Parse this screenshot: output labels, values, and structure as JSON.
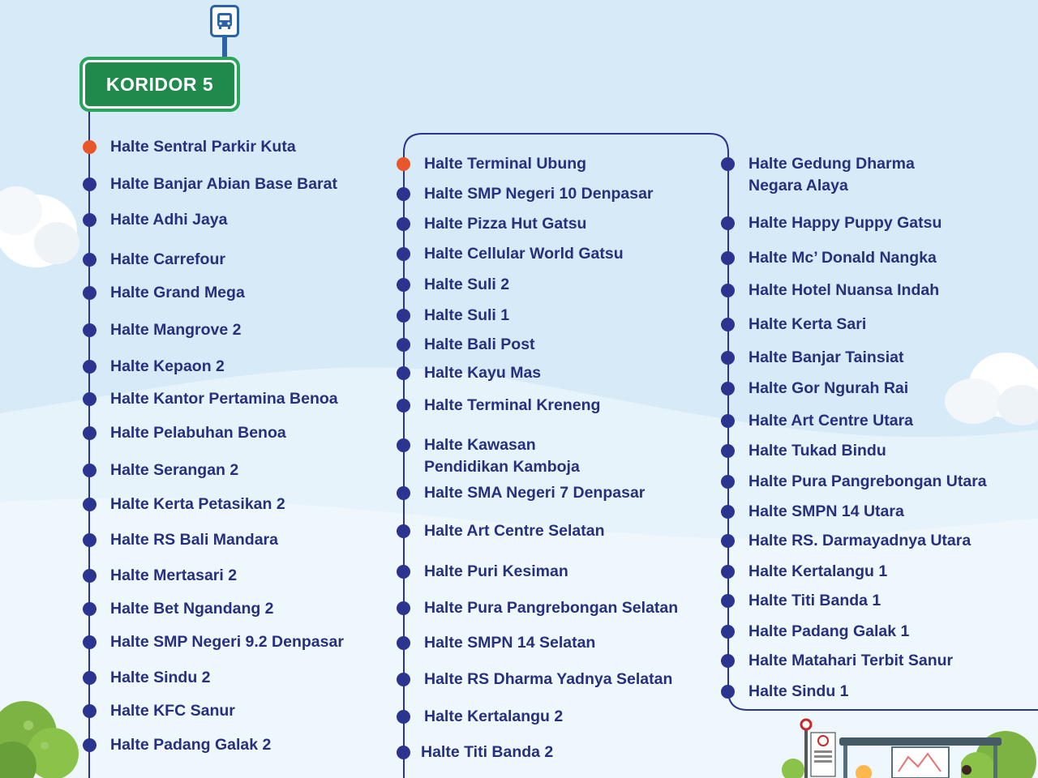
{
  "header": {
    "corridor_label": "KORIDOR 5",
    "bus_icon": "bus-stop-icon"
  },
  "colors": {
    "background_top": "#d4eaf7",
    "background_bottom": "#e8f4fb",
    "route_line": "#2b3590",
    "stop_dot": "#2b3590",
    "terminal_dot": "#e8572a",
    "text": "#27307d",
    "sign_green": "#1f8a4c"
  },
  "columns": [
    {
      "stops": [
        {
          "label": "Halte Sentral Parkir Kuta",
          "terminal": true
        },
        {
          "label": "Halte Banjar Abian Base Barat"
        },
        {
          "label": "Halte Adhi Jaya"
        },
        {
          "label": "Halte Carrefour"
        },
        {
          "label": "Halte Grand Mega"
        },
        {
          "label": "Halte Mangrove 2"
        },
        {
          "label": "Halte Kepaon 2"
        },
        {
          "label": "Halte Kantor Pertamina Benoa"
        },
        {
          "label": "Halte Pelabuhan Benoa"
        },
        {
          "label": "Halte Serangan 2"
        },
        {
          "label": "Halte Kerta Petasikan 2"
        },
        {
          "label": "Halte RS Bali Mandara"
        },
        {
          "label": "Halte Mertasari 2"
        },
        {
          "label": "Halte Bet Ngandang 2"
        },
        {
          "label": "Halte SMP Negeri 9.2 Denpasar"
        },
        {
          "label": "Halte Sindu 2"
        },
        {
          "label": "Halte KFC Sanur"
        },
        {
          "label": "Halte Padang Galak 2"
        }
      ]
    },
    {
      "stops": [
        {
          "label": "Halte Terminal Ubung",
          "terminal": true
        },
        {
          "label": "Halte SMP Negeri 10 Denpasar"
        },
        {
          "label": "Halte Pizza Hut Gatsu"
        },
        {
          "label": "Halte Cellular World Gatsu"
        },
        {
          "label": "Halte Suli 2"
        },
        {
          "label": "Halte Suli 1"
        },
        {
          "label": "Halte Bali Post"
        },
        {
          "label": "Halte Kayu Mas"
        },
        {
          "label": "Halte Terminal Kreneng"
        },
        {
          "label": "Halte Kawasan\nPendidikan Kamboja"
        },
        {
          "label": "Halte SMA Negeri 7 Denpasar"
        },
        {
          "label": "Halte Art Centre Selatan"
        },
        {
          "label": "Halte Puri Kesiman"
        },
        {
          "label": "Halte Pura Pangrebongan Selatan"
        },
        {
          "label": "Halte SMPN 14 Selatan"
        },
        {
          "label": "Halte RS Dharma Yadnya Selatan"
        },
        {
          "label": "Halte Kertalangu 2"
        },
        {
          "label": "Halte Titi Banda 2"
        }
      ]
    },
    {
      "stops": [
        {
          "label": "Halte Gedung Dharma\nNegara Alaya"
        },
        {
          "label": "Halte Happy Puppy Gatsu"
        },
        {
          "label": "Halte Mc’ Donald Nangka"
        },
        {
          "label": "Halte Hotel Nuansa Indah"
        },
        {
          "label": "Halte Kerta Sari"
        },
        {
          "label": "Halte Banjar Tainsiat"
        },
        {
          "label": "Halte Gor Ngurah Rai"
        },
        {
          "label": "Halte Art Centre Utara"
        },
        {
          "label": "Halte Tukad Bindu"
        },
        {
          "label": "Halte Pura Pangrebongan Utara"
        },
        {
          "label": "Halte SMPN 14 Utara"
        },
        {
          "label": "Halte RS. Darmayadnya Utara"
        },
        {
          "label": "Halte Kertalangu 1"
        },
        {
          "label": "Halte Titi Banda 1"
        },
        {
          "label": "Halte Padang Galak 1"
        },
        {
          "label": "Halte Matahari Terbit Sanur"
        },
        {
          "label": "Halte Sindu 1"
        }
      ]
    }
  ]
}
